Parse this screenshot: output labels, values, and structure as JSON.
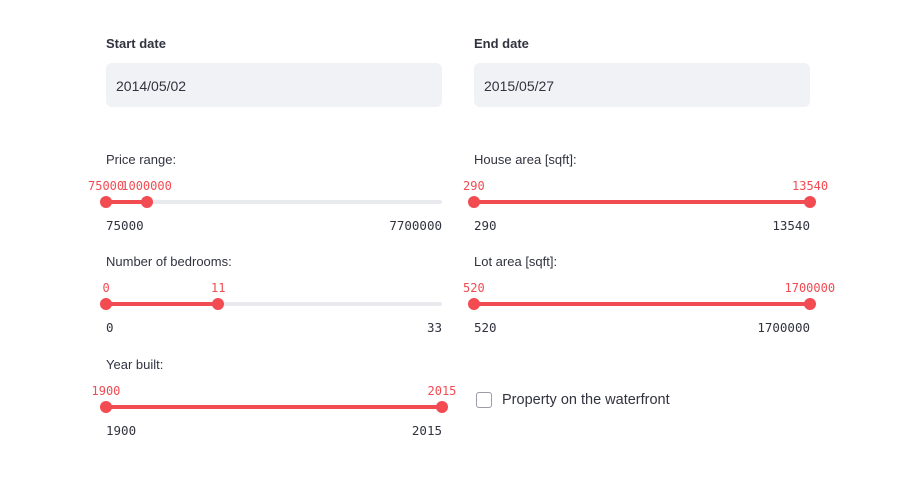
{
  "dates": {
    "start_label": "Start date",
    "start_value": "2014/05/02",
    "end_label": "End date",
    "end_value": "2015/05/27"
  },
  "sliders": {
    "price": {
      "label": "Price range:",
      "min": 75000,
      "max": 7700000,
      "low": 75000,
      "high": 1000000,
      "min_text": "75000",
      "max_text": "7700000",
      "low_text": "75000",
      "high_text": "1000000"
    },
    "house_area": {
      "label": "House area [sqft]:",
      "min": 290,
      "max": 13540,
      "low": 290,
      "high": 13540,
      "min_text": "290",
      "max_text": "13540",
      "low_text": "290",
      "high_text": "13540"
    },
    "bedrooms": {
      "label": "Number of bedrooms:",
      "min": 0,
      "max": 33,
      "low": 0,
      "high": 11,
      "min_text": "0",
      "max_text": "33",
      "low_text": "0",
      "high_text": "11"
    },
    "lot_area": {
      "label": "Lot area [sqft]:",
      "min": 520,
      "max": 1700000,
      "low": 520,
      "high": 1700000,
      "min_text": "520",
      "max_text": "1700000",
      "low_text": "520",
      "high_text": "1700000"
    },
    "year_built": {
      "label": "Year built:",
      "min": 1900,
      "max": 2015,
      "low": 1900,
      "high": 2015,
      "min_text": "1900",
      "max_text": "2015",
      "low_text": "1900",
      "high_text": "2015"
    }
  },
  "waterfront": {
    "label": "Property on the waterfront",
    "checked": false
  },
  "colors": {
    "accent": "#f24b52",
    "input_bg": "#f0f2f6",
    "text": "#31333f"
  }
}
